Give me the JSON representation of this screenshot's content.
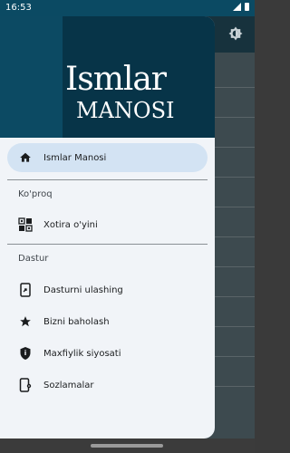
{
  "status_bar": {
    "time": "16:53"
  },
  "header": {
    "logo_line1": "Ismlar",
    "logo_line2": "MANOSI"
  },
  "menu": {
    "home": {
      "label": "Ismlar Manosi",
      "icon": "home-icon"
    },
    "section_more": "Ko'proq",
    "memory_game": {
      "label": "Xotira o'yini",
      "icon": "memory-game-icon"
    },
    "section_app": "Dastur",
    "items": [
      {
        "label": "Dasturni ulashing",
        "icon": "share-icon"
      },
      {
        "label": "Bizni baholash",
        "icon": "star-icon"
      },
      {
        "label": "Maxfiylik siyosati",
        "icon": "shield-icon"
      },
      {
        "label": "Sozlamalar",
        "icon": "settings-icon"
      }
    ]
  },
  "colors": {
    "header": "#0c4a63",
    "header_panel": "#073448",
    "active": "#d3e3f3",
    "drawer_bg": "#f1f4f8"
  }
}
